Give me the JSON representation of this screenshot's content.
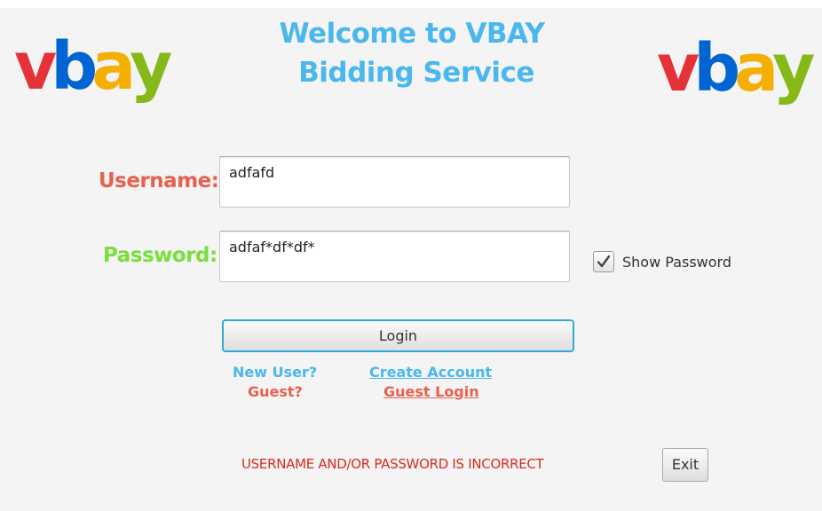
{
  "logos": {
    "letters": [
      "v",
      "b",
      "a",
      "y"
    ],
    "colors": [
      "#e53238",
      "#0064d2",
      "#f5af02",
      "#86b817"
    ]
  },
  "header": {
    "line1": "Welcome to VBAY",
    "line2": "Bidding Service",
    "color": "#4ab7ee"
  },
  "form": {
    "username_label": "Username:",
    "username_value": "adfafd",
    "password_label": "Password:",
    "password_value": "adfaf*df*df*",
    "show_password_label": "Show Password",
    "show_password_checked": true,
    "login_label": "Login"
  },
  "links": {
    "new_user_prompt": "New User?",
    "create_account": "Create Account",
    "guest_prompt": "Guest?",
    "guest_login": "Guest Login"
  },
  "status": {
    "error_message": "USERNAME AND/OR PASSWORD IS INCORRECT",
    "error_color": "#d82b1f"
  },
  "exit_label": "Exit",
  "colors": {
    "username_label": "#e8604f",
    "password_label": "#7bdd3f",
    "focus_border": "#34a8d8"
  }
}
